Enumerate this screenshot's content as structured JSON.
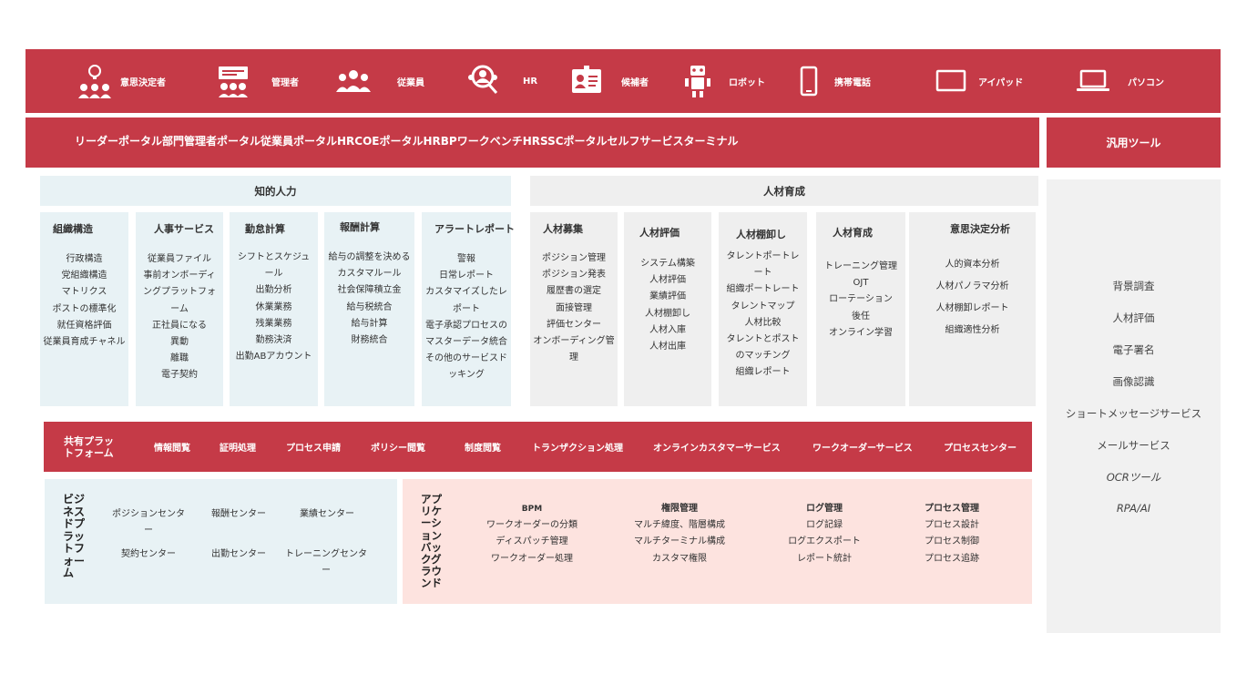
{
  "users": [
    {
      "label": "意思決定者",
      "icon": "decision-maker-icon"
    },
    {
      "label": "管理者",
      "icon": "manager-icon"
    },
    {
      "label": "従業員",
      "icon": "employees-icon"
    },
    {
      "label": "HR",
      "icon": "hr-icon"
    },
    {
      "label": "候補者",
      "icon": "candidate-icon"
    },
    {
      "label": "ロボット",
      "icon": "robot-icon"
    },
    {
      "label": "携帯電話",
      "icon": "mobile-phone-icon"
    },
    {
      "label": "アイパッド",
      "icon": "tablet-icon"
    },
    {
      "label": "パソコン",
      "icon": "laptop-icon"
    }
  ],
  "portal_text": "リーダーポータル部門管理者ポータル従業員ポータルHRCOEポータルHRBPワークベンチHRSSCポータルセルフサービスターミナル",
  "tools": {
    "title": "汎用ツール",
    "items": [
      "背景調査",
      "人材評価",
      "電子署名",
      "画像認識",
      "ショートメッセージサービス",
      "メールサービス",
      "OCRツール",
      "RPA/AI"
    ]
  },
  "intellectual_capital": {
    "title": "知的人力",
    "columns": [
      {
        "title": "組織構造",
        "items": [
          "行政構造",
          "党組織構造",
          "マトリクス",
          "ポストの標準化",
          "就任資格評価",
          "従業員育成チャネル"
        ]
      },
      {
        "title": "人事サービス",
        "items": [
          "従業員ファイル",
          "事前オンボーディ",
          "ングプラットフォ",
          "ーム",
          "正社員になる",
          "異動",
          "離職",
          "電子契約"
        ]
      },
      {
        "title": "勤怠計算",
        "items": [
          "シフトとスケジュ",
          "ール",
          "出勤分析",
          "休業業務",
          "残業業務",
          "勤務決済",
          "出勤ABアカウント"
        ]
      },
      {
        "title": "報酬計算",
        "items": [
          "給与の調整を決める",
          "カスタマルール",
          "社会保障積立金",
          "給与税統合",
          "給与計算",
          "財務統合"
        ]
      },
      {
        "title": "アラートレポート",
        "items": [
          "警報",
          "日常レポート",
          "カスタマイズしたレ",
          "ポート",
          "電子承認プロセスの",
          "マスターデータ統合",
          "その他のサービスド",
          "ッキング"
        ]
      }
    ]
  },
  "talent_development": {
    "title": "人材育成",
    "columns": [
      {
        "title": "人材募集",
        "items": [
          "ポジション管理",
          "ポジション発表",
          "履歴書の選定",
          "面接管理",
          "評価センター",
          "オンボーディング管",
          "理"
        ]
      },
      {
        "title": "人材評価",
        "items": [
          "システム構築",
          "人材評価",
          "業績評価",
          "人材棚卸し",
          "人材入庫",
          "人材出庫"
        ]
      },
      {
        "title": "人材棚卸し",
        "items": [
          "タレントポートレ",
          "ート",
          "組織ポートレート",
          "タレントマップ",
          "人材比較",
          "タレントとポスト",
          "のマッチング",
          "組織レポート"
        ]
      },
      {
        "title": "人材育成",
        "items": [
          "トレーニング管理",
          "OJT",
          "ローテーション",
          "後任",
          "オンライン学習"
        ]
      },
      {
        "title": "意思決定分析",
        "items": [
          "人的資本分析",
          "人材パノラマ分析",
          "人材棚卸レポート",
          "組織適性分析"
        ]
      }
    ]
  },
  "shared_platform": {
    "title": "共有プラットフォーム",
    "items": [
      "情報閲覧",
      "証明処理",
      "プロセス申請",
      "ポリシー閲覧",
      "制度閲覧",
      "トランザクション処理",
      "オンラインカスタマーサービス",
      "ワークオーダーサービス",
      "プロセスセンター"
    ]
  },
  "business_platform": {
    "title": "ビジネスドプラットフォーム",
    "items": [
      "ポジションセンター",
      "報酬センター",
      "業績センター",
      "契約センター",
      "出勤センター",
      "トレーニングセンター"
    ]
  },
  "app_background": {
    "title": "アプリケーションバックグラウンド",
    "groups": [
      {
        "title": "BPM",
        "items": [
          "ワークオーダーの分類",
          "ディスパッチ管理",
          "ワークオーダー処理"
        ]
      },
      {
        "title": "権限管理",
        "items": [
          "マルチ緯度、階層構成",
          "マルチターミナル構成",
          "カスタマ権限"
        ]
      },
      {
        "title": "ログ管理",
        "items": [
          "ログ記録",
          "ログエクスポート",
          "レポート統計"
        ]
      },
      {
        "title": "プロセス管理",
        "items": [
          "プロセス設計",
          "プロセス制御",
          "プロセス追跡"
        ]
      }
    ]
  }
}
